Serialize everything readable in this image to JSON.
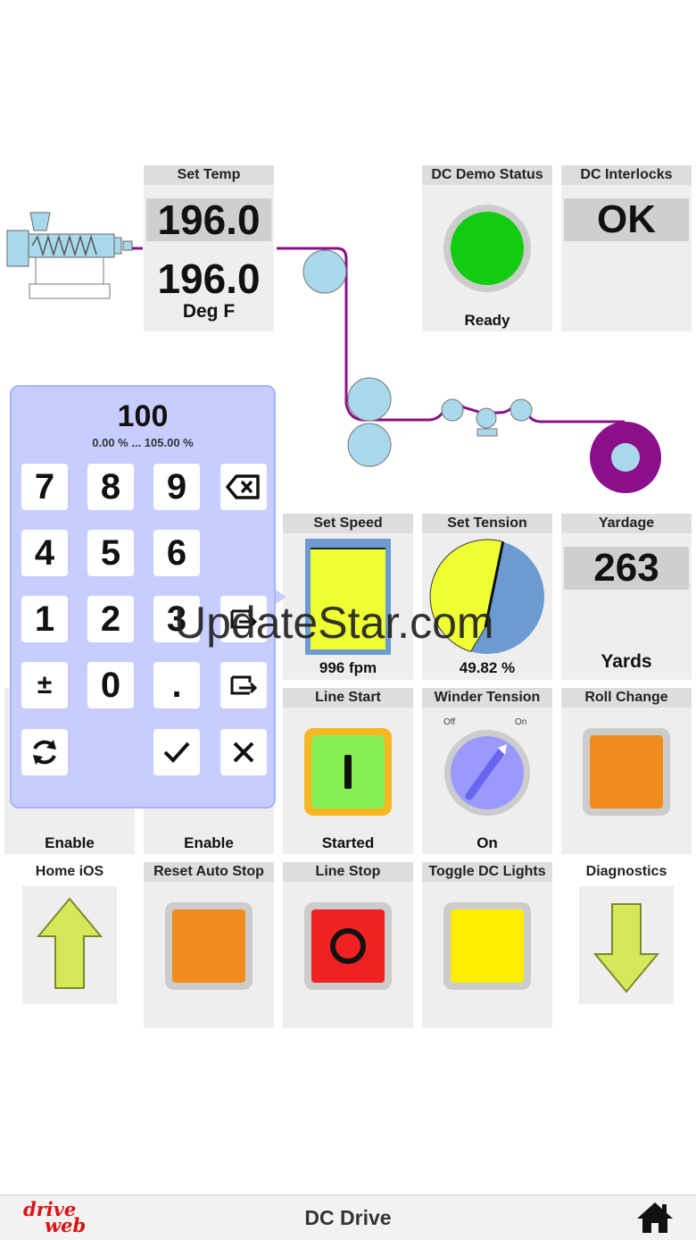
{
  "set_temp": {
    "title": "Set Temp",
    "setpoint": "196.0",
    "actual": "196.0",
    "unit": "Deg F"
  },
  "demo_status": {
    "title": "DC Demo Status",
    "state": "Ready",
    "color": "#11cc11"
  },
  "interlocks": {
    "title": "DC Interlocks",
    "value": "OK"
  },
  "keypad": {
    "value": "100",
    "range": "0.00 % ... 105.00 %",
    "keys": [
      "7",
      "8",
      "9",
      "4",
      "5",
      "6",
      "1",
      "2",
      "3",
      "±",
      "0",
      "."
    ]
  },
  "set_speed": {
    "title": "Set Speed",
    "value": "996 fpm",
    "fill_fraction": 0.95
  },
  "set_tension": {
    "title": "Set Tension",
    "value": "49.82 %",
    "percent": 49.82
  },
  "yardage": {
    "title": "Yardage",
    "value": "263",
    "unit": "Yards"
  },
  "enable_1": {
    "label": "Enable"
  },
  "enable_2": {
    "label": "Enable"
  },
  "line_start": {
    "title": "Line Start",
    "state": "Started"
  },
  "winder_tension": {
    "title": "Winder Tension",
    "off_label": "Off",
    "on_label": "On",
    "state": "On"
  },
  "roll_change": {
    "title": "Roll Change"
  },
  "home_ios": {
    "title": "Home iOS"
  },
  "reset_auto_stop": {
    "title": "Reset Auto Stop"
  },
  "line_stop": {
    "title": "Line Stop"
  },
  "toggle_dc_lights": {
    "title": "Toggle DC Lights"
  },
  "diagnostics": {
    "title": "Diagnostics"
  },
  "watermark": "UpdateStar.com",
  "footer": {
    "title": "DC Drive",
    "logo_top": "drive",
    "logo_bottom": "web"
  },
  "colors": {
    "web_line": "#8b0f8b",
    "roller": "#a8d8ea",
    "orange": "#f08c1e",
    "red": "#ee2222",
    "yellow": "#ffee00",
    "green_btn": "#88ee55",
    "arrow": "#d4e85a"
  }
}
